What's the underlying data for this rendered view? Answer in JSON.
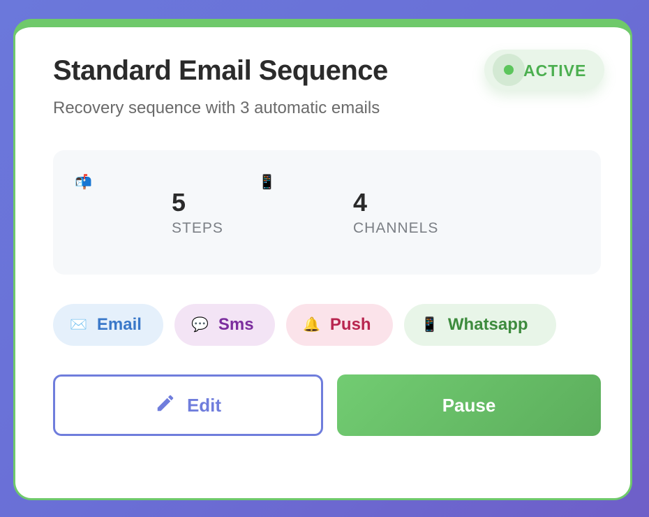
{
  "card": {
    "title": "Standard Email Sequence",
    "subtitle": "Recovery sequence with 3 automatic emails",
    "status": "ACTIVE"
  },
  "stats": [
    {
      "icon": "mailbox-icon",
      "glyph": "📬",
      "value": "5",
      "label": "STEPS"
    },
    {
      "icon": "mobile-phone-icon",
      "glyph": "📱",
      "value": "4",
      "label": "CHANNELS"
    }
  ],
  "channels": [
    {
      "icon": "envelope-icon",
      "glyph": "✉️",
      "label": "Email",
      "color": "#3a78c9",
      "bg": "#e5f0fb"
    },
    {
      "icon": "speech-bubble-icon",
      "glyph": "💬",
      "label": "Sms",
      "color": "#7b2d9e",
      "bg": "#f3e4f5"
    },
    {
      "icon": "bell-icon",
      "glyph": "🔔",
      "label": "Push",
      "color": "#b8254f",
      "bg": "#fbe3ea"
    },
    {
      "icon": "mobile-phone-icon",
      "glyph": "📱",
      "label": "Whatsapp",
      "color": "#3d8b3d",
      "bg": "#e8f5e8"
    }
  ],
  "actions": {
    "edit_label": "Edit",
    "pause_label": "Pause"
  },
  "colors": {
    "accent_green": "#6fc96b",
    "accent_blue": "#6f7ddc",
    "background": "#6b78db"
  }
}
